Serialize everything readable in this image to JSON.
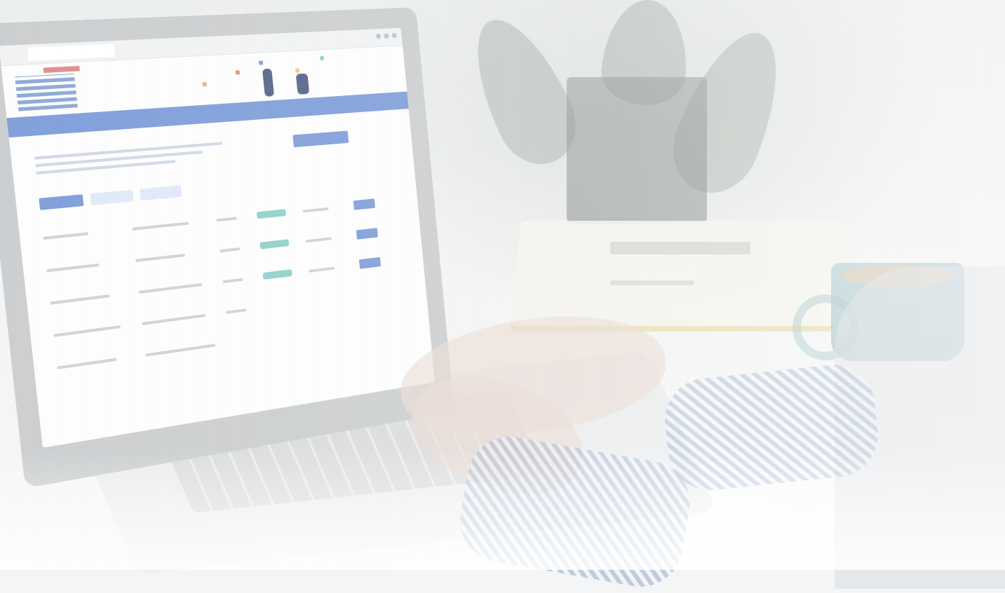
{
  "scene": {
    "description_icon": "laptop-workspace-photo",
    "palette": {
      "accent_blue": "#6c90d4",
      "status_teal": "#7ecac2",
      "logo_red": "#d65a5a"
    }
  },
  "icons": {
    "browser_tab": "browser-tab-icon",
    "app_logo": "app-logo-icon",
    "plant": "plant-icon",
    "mug": "coffee-mug-icon",
    "book": "book-icon"
  }
}
